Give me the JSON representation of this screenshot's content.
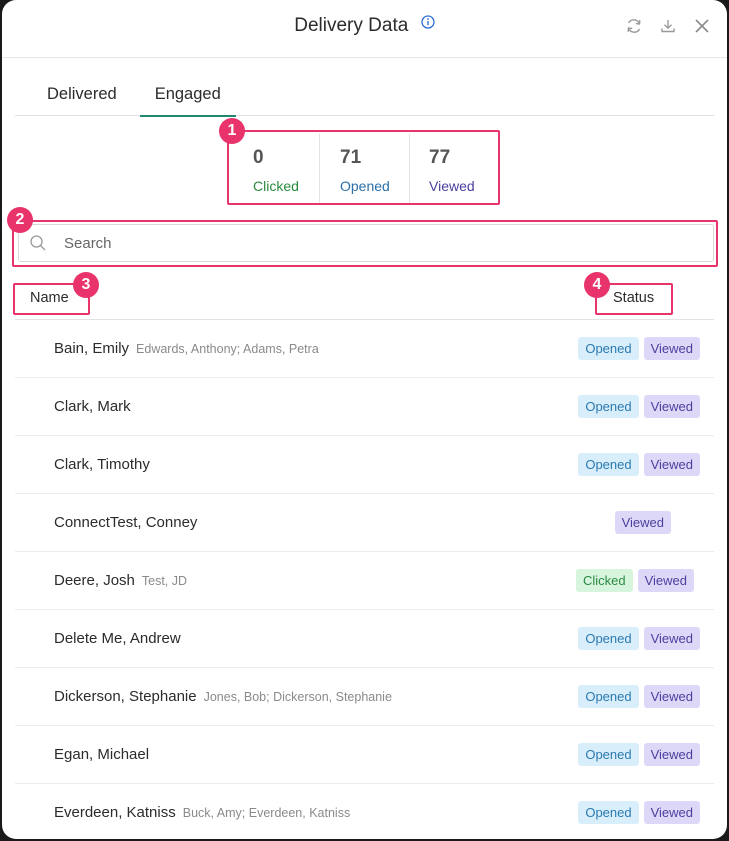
{
  "header": {
    "title": "Delivery Data"
  },
  "tabs": [
    {
      "label": "Delivered",
      "active": false
    },
    {
      "label": "Engaged",
      "active": true
    }
  ],
  "stats": [
    {
      "value": "0",
      "label": "Clicked",
      "color": "#2a8a3e"
    },
    {
      "value": "71",
      "label": "Opened",
      "color": "#2a6fa8"
    },
    {
      "value": "77",
      "label": "Viewed",
      "color": "#4a3f9e"
    }
  ],
  "search": {
    "placeholder": "Search",
    "value": ""
  },
  "columns": {
    "name": "Name",
    "status": "Status"
  },
  "callouts": [
    "1",
    "2",
    "3",
    "4"
  ],
  "rows": [
    {
      "name": "Bain, Emily",
      "sub": "Edwards, Anthony; Adams, Petra",
      "statuses": [
        "Opened",
        "Viewed"
      ]
    },
    {
      "name": "Clark, Mark",
      "sub": "",
      "statuses": [
        "Opened",
        "Viewed"
      ]
    },
    {
      "name": "Clark, Timothy",
      "sub": "",
      "statuses": [
        "Opened",
        "Viewed"
      ]
    },
    {
      "name": "ConnectTest, Conney",
      "sub": "",
      "statuses": [
        "Viewed"
      ]
    },
    {
      "name": "Deere, Josh",
      "sub": "Test, JD",
      "statuses": [
        "Clicked",
        "Viewed"
      ]
    },
    {
      "name": "Delete Me, Andrew",
      "sub": "",
      "statuses": [
        "Opened",
        "Viewed"
      ]
    },
    {
      "name": "Dickerson, Stephanie",
      "sub": "Jones, Bob; Dickerson, Stephanie",
      "statuses": [
        "Opened",
        "Viewed"
      ]
    },
    {
      "name": "Egan, Michael",
      "sub": "",
      "statuses": [
        "Opened",
        "Viewed"
      ]
    },
    {
      "name": "Everdeen, Katniss",
      "sub": "Buck, Amy; Everdeen, Katniss",
      "statuses": [
        "Opened",
        "Viewed"
      ]
    }
  ],
  "colors": {
    "accent": "#1f8a70",
    "highlight": "#e8336b"
  }
}
